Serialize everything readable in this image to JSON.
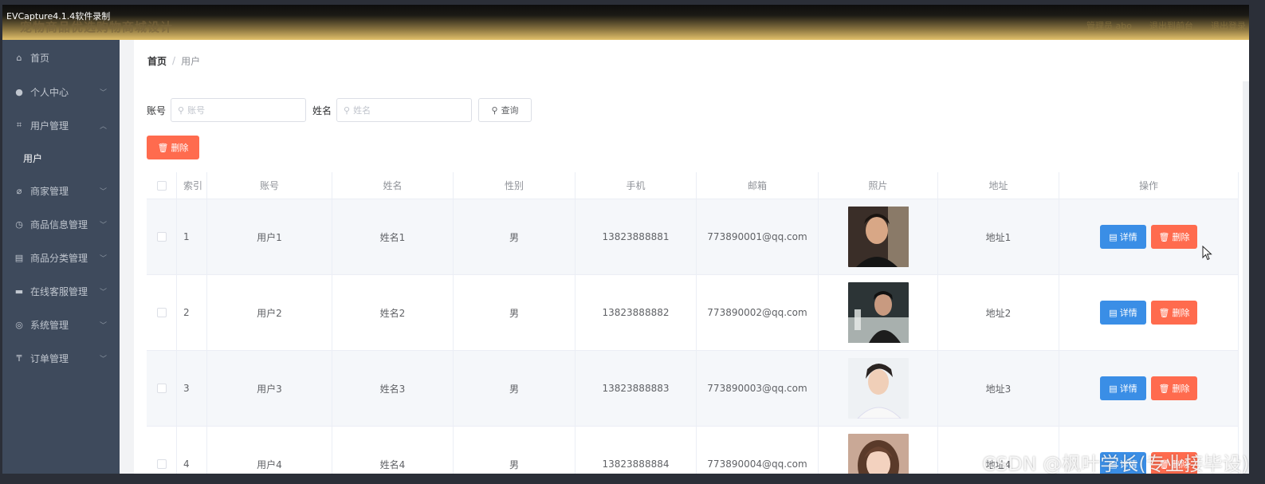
{
  "capture": {
    "label": "EVCapture4.1.4软件录制"
  },
  "header": {
    "site_title": "宠物商品优选购物商城设计",
    "links": [
      "管理员 abo",
      "退出到前台",
      "退出登录"
    ]
  },
  "sidebar": {
    "items": [
      {
        "label": "首页",
        "icon": "home-icon",
        "has_children": false
      },
      {
        "label": "个人中心",
        "icon": "user-icon",
        "has_children": true
      },
      {
        "label": "用户管理",
        "icon": "crop-icon",
        "has_children": true,
        "expanded": true
      },
      {
        "label": "用户",
        "icon": "",
        "sub": true
      },
      {
        "label": "商家管理",
        "icon": "shop-icon",
        "has_children": true
      },
      {
        "label": "商品信息管理",
        "icon": "clock-icon",
        "has_children": true
      },
      {
        "label": "商品分类管理",
        "icon": "category-icon",
        "has_children": true
      },
      {
        "label": "在线客服管理",
        "icon": "chat-icon",
        "has_children": true
      },
      {
        "label": "系统管理",
        "icon": "settings-icon",
        "has_children": true
      },
      {
        "label": "订单管理",
        "icon": "order-icon",
        "has_children": true
      }
    ]
  },
  "breadcrumb": {
    "home": "首页",
    "separator": "/",
    "current": "用户"
  },
  "search": {
    "account_label": "账号",
    "account_placeholder": "账号",
    "name_label": "姓名",
    "name_placeholder": "姓名",
    "query_label": "查询"
  },
  "toolbar": {
    "delete_label": "删除"
  },
  "table": {
    "headers": [
      "索引",
      "账号",
      "姓名",
      "性别",
      "手机",
      "邮箱",
      "照片",
      "地址",
      "操作"
    ],
    "detail_label": "详情",
    "delete_label": "删除",
    "rows": [
      {
        "index": "1",
        "account": "用户1",
        "name": "姓名1",
        "gender": "男",
        "phone": "13823888881",
        "email": "773890001@qq.com",
        "address": "地址1"
      },
      {
        "index": "2",
        "account": "用户2",
        "name": "姓名2",
        "gender": "男",
        "phone": "13823888882",
        "email": "773890002@qq.com",
        "address": "地址2"
      },
      {
        "index": "3",
        "account": "用户3",
        "name": "姓名3",
        "gender": "男",
        "phone": "13823888883",
        "email": "773890003@qq.com",
        "address": "地址3"
      },
      {
        "index": "4",
        "account": "用户4",
        "name": "姓名4",
        "gender": "男",
        "phone": "13823888884",
        "email": "773890004@qq.com",
        "address": "地址4"
      }
    ]
  },
  "watermark": "CSDN @枫叶学长(专业接毕设)",
  "colors": {
    "primary": "#3a8ee6",
    "danger": "#ff6b4e",
    "sidebar": "#3e4a5c"
  }
}
